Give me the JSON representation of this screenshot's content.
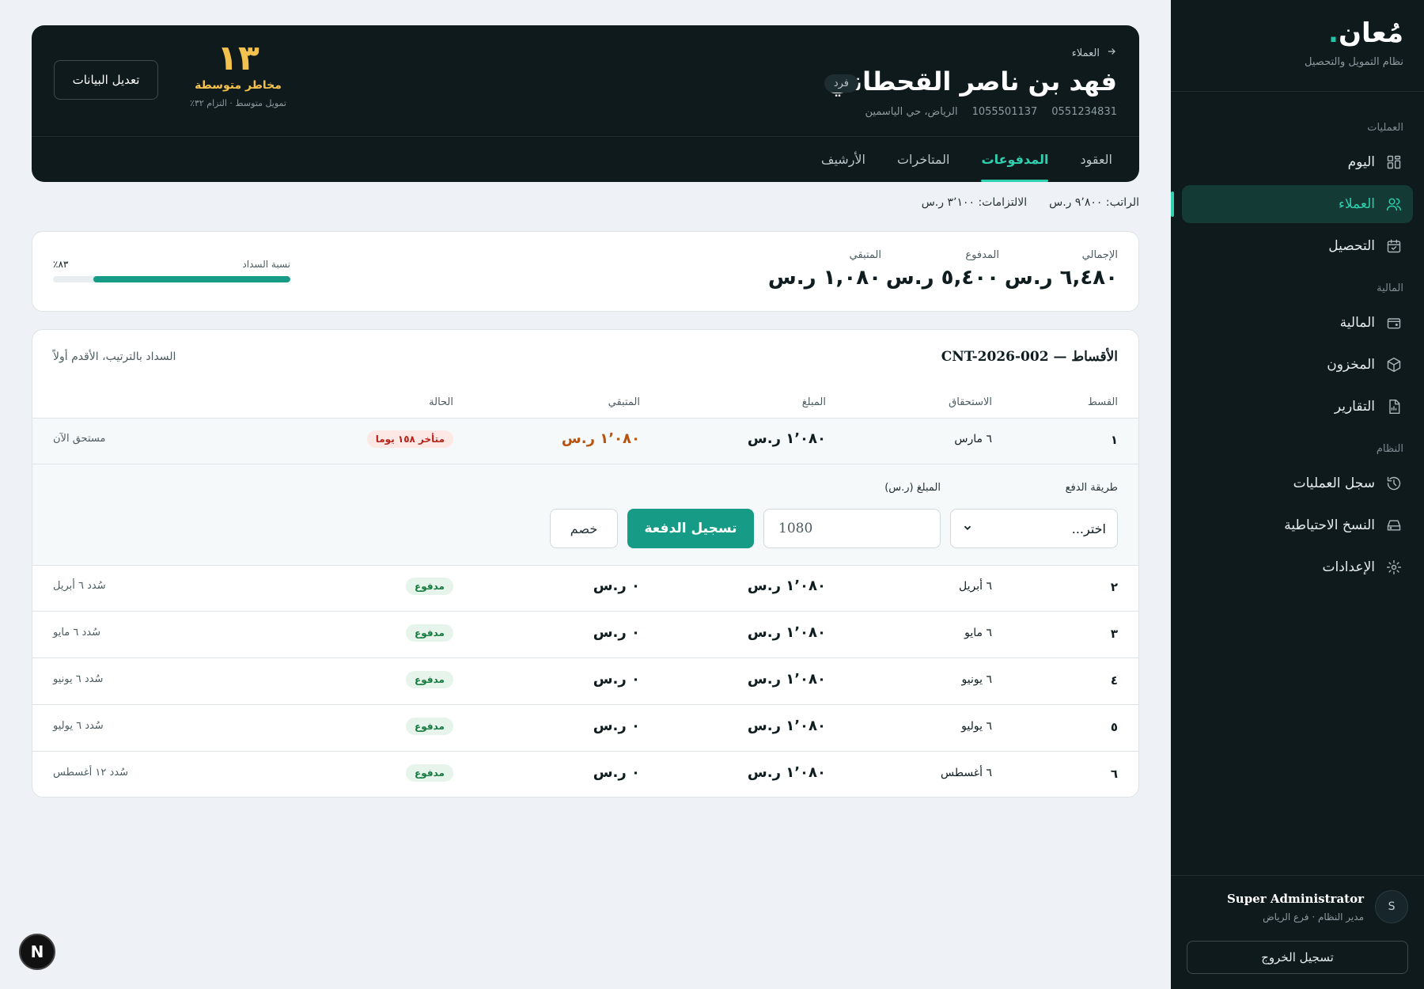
{
  "sidebar": {
    "brand": "مُعان",
    "brand_dot": ".",
    "brand_sub": "نظام التمويل والتحصيل",
    "sections": [
      {
        "title": "العمليات",
        "items": [
          {
            "label": "اليوم",
            "icon": "dashboard-icon",
            "active": false
          },
          {
            "label": "العملاء",
            "icon": "users-icon",
            "active": true
          },
          {
            "label": "التحصيل",
            "icon": "calendar-check-icon",
            "active": false
          }
        ]
      },
      {
        "title": "المالية",
        "items": [
          {
            "label": "المالية",
            "icon": "wallet-icon",
            "active": false
          },
          {
            "label": "المخزون",
            "icon": "box-icon",
            "active": false
          },
          {
            "label": "التقارير",
            "icon": "report-icon",
            "active": false
          }
        ]
      },
      {
        "title": "النظام",
        "items": [
          {
            "label": "سجل العمليات",
            "icon": "history-icon",
            "active": false
          },
          {
            "label": "النسخ الاحتياطية",
            "icon": "storage-icon",
            "active": false
          },
          {
            "label": "الإعدادات",
            "icon": "gear-icon",
            "active": false
          }
        ]
      }
    ],
    "user": {
      "initial": "S",
      "name": "Super Administrator",
      "role": "مدير النظام · فرع الرياض"
    },
    "logout": "تسجيل الخروج"
  },
  "header": {
    "breadcrumb": "العملاء",
    "client_name": "فهد بن ناصر القحطاني",
    "client_type": "فرد",
    "phone": "0551234831",
    "national_id": "1055501137",
    "address": "الرياض، حي الياسمين",
    "risk_score": "١٣",
    "risk_label": "مخاطر متوسطة",
    "risk_sub": "تمويل متوسط · التزام ٣٢٪",
    "edit_button": "تعديل البيانات",
    "tabs": [
      {
        "label": "العقود",
        "active": false
      },
      {
        "label": "المدفوعات",
        "active": true
      },
      {
        "label": "المتاخرات",
        "active": false
      },
      {
        "label": "الأرشيف",
        "active": false
      }
    ]
  },
  "salary": {
    "salary_text": "الراتب: ٩٬٨٠٠ ر.س",
    "obligations_text": "الالتزامات: ٣٬١٠٠ ر.س"
  },
  "summary": {
    "total_label": "الإجمالي",
    "total_value": "٦,٤٨٠ ر.س",
    "paid_label": "المدفوع",
    "paid_value": "٥,٤٠٠ ر.س",
    "remaining_label": "المتبقي",
    "remaining_value": "١,٠٨٠ ر.س",
    "progress_label": "نسبة السداد",
    "progress_text": "٨٣٪",
    "progress_fraction": 0.83
  },
  "installments": {
    "title": "الأقساط — CNT-2026-002",
    "note": "السداد بالترتيب، الأقدم أولاً",
    "headers": {
      "num": "القسط",
      "due": "الاستحقاق",
      "amount": "المبلغ",
      "remaining": "المتبقي",
      "status": "الحالة"
    },
    "rows": [
      {
        "num": "١",
        "due": "٦ مارس",
        "amount": "١٬٠٨٠ ر.س",
        "remaining": "١٬٠٨٠ ر.س",
        "status": "متأخر ١٥٨ يوما",
        "status_type": "late",
        "note": "مستحق الآن"
      },
      {
        "num": "٢",
        "due": "٦ أبريل",
        "amount": "١٬٠٨٠ ر.س",
        "remaining": "٠ ر.س",
        "status": "مدفوع",
        "status_type": "paid",
        "note": "سُدد ٦ أبريل"
      },
      {
        "num": "٣",
        "due": "٦ مايو",
        "amount": "١٬٠٨٠ ر.س",
        "remaining": "٠ ر.س",
        "status": "مدفوع",
        "status_type": "paid",
        "note": "سُدد ٦ مايو"
      },
      {
        "num": "٤",
        "due": "٦ يونيو",
        "amount": "١٬٠٨٠ ر.س",
        "remaining": "٠ ر.س",
        "status": "مدفوع",
        "status_type": "paid",
        "note": "سُدد ٦ يونيو"
      },
      {
        "num": "٥",
        "due": "٦ يوليو",
        "amount": "١٬٠٨٠ ر.س",
        "remaining": "٠ ر.س",
        "status": "مدفوع",
        "status_type": "paid",
        "note": "سُدد ٦ يوليو"
      },
      {
        "num": "٦",
        "due": "٦ أغسطس",
        "amount": "١٬٠٨٠ ر.س",
        "remaining": "٠ ر.س",
        "status": "مدفوع",
        "status_type": "paid",
        "note": "سُدد ١٢ أغسطس"
      }
    ],
    "form": {
      "method_label": "طريقة الدفع",
      "method_value": "اختر...",
      "amount_label": "المبلغ (ر.س)",
      "amount_value": "1080",
      "submit": "تسجيل الدفعة",
      "discount": "خصم"
    }
  },
  "fab": {
    "letter": "N"
  },
  "colors": {
    "accent": "#169c86",
    "accent_light": "#2fd0b0",
    "dark": "#0f1a1d",
    "warning": "#f2c14e",
    "late": "#b42318",
    "paid": "#157a3e"
  }
}
